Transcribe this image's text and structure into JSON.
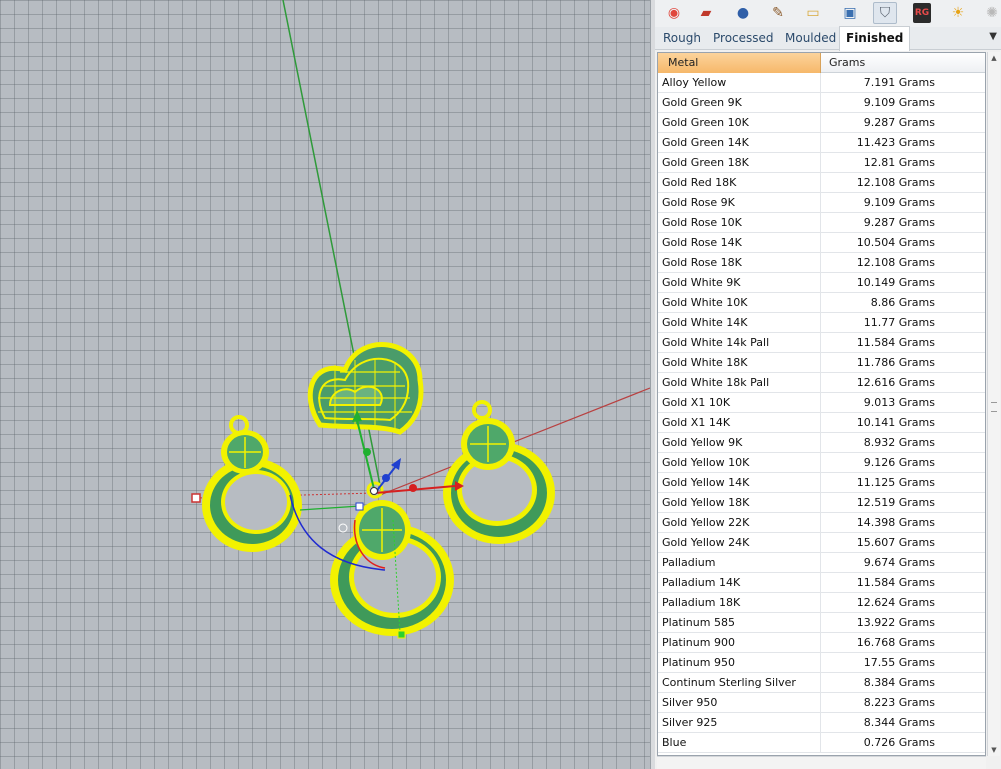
{
  "toolbar": {
    "icons": [
      {
        "name": "color-wheel-icon",
        "glyph": "◉",
        "color": "#e0463c"
      },
      {
        "name": "layers-icon",
        "glyph": "▰",
        "color": "#c0392b"
      },
      {
        "name": "materials-icon",
        "glyph": "●",
        "color": "#2f5fa8"
      },
      {
        "name": "brush-icon",
        "glyph": "✎",
        "color": "#8a5a2b"
      },
      {
        "name": "folder-icon",
        "glyph": "▭",
        "color": "#d8a93c"
      },
      {
        "name": "display-icon",
        "glyph": "▣",
        "color": "#3a6fb0"
      },
      {
        "name": "weight-icon",
        "glyph": "⛉",
        "color": "#5b6470"
      },
      {
        "name": "rg-icon",
        "glyph": "RG",
        "color": "#cc2a2a"
      },
      {
        "name": "sun-icon",
        "glyph": "☀",
        "color": "#e6a317"
      },
      {
        "name": "settings-icon",
        "glyph": "✺",
        "color": "#b9b9b9"
      }
    ]
  },
  "tabs": [
    "Rough",
    "Processed",
    "Moulded",
    "Finished"
  ],
  "active_tab": "Finished",
  "table": {
    "columns": [
      "Metal",
      "Grams"
    ],
    "rows": [
      [
        "Alloy Yellow",
        "7.191 Grams"
      ],
      [
        "Gold Green 9K",
        "9.109 Grams"
      ],
      [
        "Gold Green 10K",
        "9.287 Grams"
      ],
      [
        "Gold Green 14K",
        "11.423 Grams"
      ],
      [
        "Gold Green 18K",
        "12.81 Grams"
      ],
      [
        "Gold Red 18K",
        "12.108 Grams"
      ],
      [
        "Gold Rose 9K",
        "9.109 Grams"
      ],
      [
        "Gold Rose 10K",
        "9.287 Grams"
      ],
      [
        "Gold Rose 14K",
        "10.504 Grams"
      ],
      [
        "Gold Rose 18K",
        "12.108 Grams"
      ],
      [
        "Gold White 9K",
        "10.149 Grams"
      ],
      [
        "Gold White 10K",
        "8.86 Grams"
      ],
      [
        "Gold White 14K",
        "11.77 Grams"
      ],
      [
        "Gold White 14k Pall",
        "11.584 Grams"
      ],
      [
        "Gold White 18K",
        "11.786 Grams"
      ],
      [
        "Gold White 18k Pall",
        "12.616 Grams"
      ],
      [
        "Gold X1 10K",
        "9.013 Grams"
      ],
      [
        "Gold X1 14K",
        "10.141 Grams"
      ],
      [
        "Gold Yellow 9K",
        "8.932 Grams"
      ],
      [
        "Gold Yellow 10K",
        "9.126 Grams"
      ],
      [
        "Gold Yellow 14K",
        "11.125 Grams"
      ],
      [
        "Gold Yellow 18K",
        "12.519 Grams"
      ],
      [
        "Gold Yellow 22K",
        "14.398 Grams"
      ],
      [
        "Gold Yellow 24K",
        "15.607 Grams"
      ],
      [
        "Palladium",
        "9.674 Grams"
      ],
      [
        "Palladium 14K",
        "11.584 Grams"
      ],
      [
        "Palladium 18K",
        "12.624 Grams"
      ],
      [
        "Platinum 585",
        "13.922 Grams"
      ],
      [
        "Platinum 900",
        "16.768 Grams"
      ],
      [
        "Platinum 950",
        "17.55 Grams"
      ],
      [
        "Continum Sterling Silver",
        "8.384 Grams"
      ],
      [
        "Silver 950",
        "8.223 Grams"
      ],
      [
        "Silver 925",
        "8.344 Grams"
      ],
      [
        "Blue",
        "0.726 Grams"
      ]
    ]
  },
  "colors": {
    "selection_yellow": "#f2f200",
    "model_green": "#3f9a5a",
    "header_orange": "#f8c27c"
  }
}
